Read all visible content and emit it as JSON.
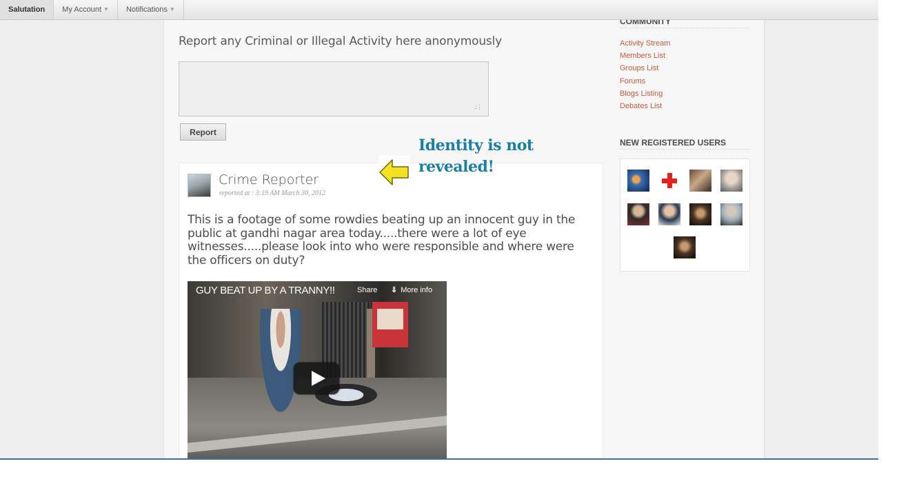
{
  "toolbar": {
    "items": [
      {
        "label": "Salutation"
      },
      {
        "label": "My Account"
      },
      {
        "label": "Notifications"
      }
    ]
  },
  "report": {
    "heading": "Report any Criminal or Illegal Activity here anonymously",
    "textarea_value": "",
    "button_label": "Report"
  },
  "annotation": {
    "line1": "Identity is not",
    "line2": "revealed!",
    "color": "#1a7ea6",
    "arrow_color": "#f3e21f"
  },
  "post": {
    "author": "Crime Reporter",
    "timestamp": "reported at : 3:19 AM March 30, 2012",
    "body": "This is a footage of some rowdies beating up an innocent guy in the public at gandhi nagar area today.....there were a lot of eye witnesses.....please look into who were responsible and where were the officers on duty?",
    "video": {
      "title": "GUY BEAT UP BY A TRANNY!!",
      "share_label": "Share",
      "more_info_label": "More info"
    }
  },
  "sidebar": {
    "community_heading": "COMMUNITY",
    "community_links": [
      "Activity Stream",
      "Members List",
      "Groups List",
      "Forums",
      "Blogs Listing",
      "Debates List"
    ],
    "new_users_heading": "NEW REGISTERED USERS",
    "link_color": "#c3593e"
  }
}
